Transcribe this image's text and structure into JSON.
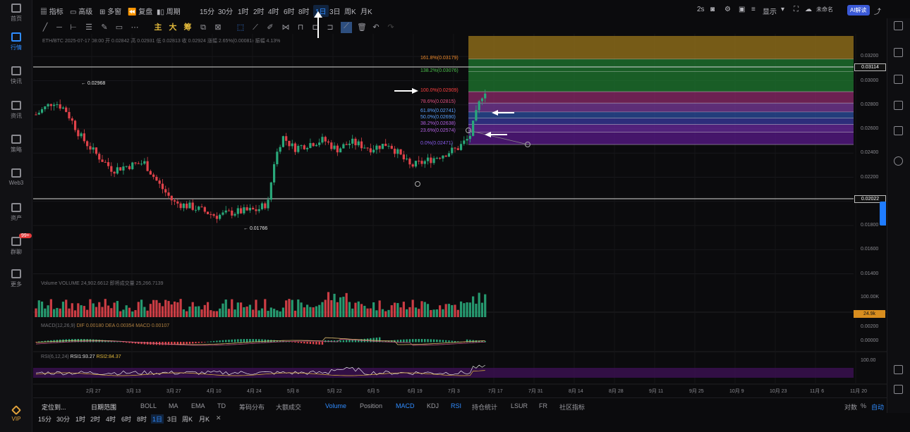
{
  "left_nav": {
    "items": [
      {
        "label": "首页",
        "icon": "home-icon"
      },
      {
        "label": "行情",
        "icon": "market-chart-icon"
      },
      {
        "label": "快讯",
        "icon": "flash-news-icon"
      },
      {
        "label": "资讯",
        "icon": "news-icon"
      },
      {
        "label": "策略",
        "icon": "strategy-icon"
      },
      {
        "label": "Web3",
        "icon": "web3-icon"
      },
      {
        "label": "资产",
        "icon": "assets-icon"
      },
      {
        "label": "群聊",
        "icon": "chat-icon"
      },
      {
        "label": "更多",
        "icon": "more-icon"
      },
      {
        "label": "VIP",
        "icon": "vip-diamond-icon"
      }
    ],
    "chat_badge": "99+"
  },
  "toolbar": {
    "indicators": "指标",
    "template": "高级",
    "multi_chart": "多窗",
    "replay": "复盘",
    "chart_type": "周期",
    "timeframes": [
      "15分",
      "30分",
      "1时",
      "2时",
      "4时",
      "6时",
      "8时",
      "1日",
      "3日",
      "周K",
      "月K"
    ],
    "active_timeframe": "1日",
    "refresh": "2s",
    "display": "显示",
    "account": "未命名",
    "ai_button": "AI解读"
  },
  "info_line": "ETH/BTC  2025-07-17 08:00  开 0.02842  高 0.02931  低 0.02813  收 0.02924  涨幅 2.65%(0.00081)  振幅 4.13%",
  "chart_data": {
    "type": "candlestick",
    "symbol": "ETH/BTC",
    "interval": "1日",
    "date": "2025-07-17",
    "high_marker": "← 0.02968",
    "low_marker": "← 0.01766",
    "price_axis": [
      "0.03200",
      "0.03000",
      "0.02800",
      "0.02600",
      "0.02400",
      "0.02200",
      "0.02000",
      "0.01800",
      "0.01600",
      "0.01400"
    ],
    "horizontal_lines": [
      {
        "label": "0.03114",
        "value": 0.03114
      },
      {
        "label": "0.02022",
        "value": 0.02022
      }
    ],
    "fibonacci": [
      {
        "label": "161.8%(0.03179)",
        "value": 0.03179,
        "color": "#f08a2a"
      },
      {
        "label": "138.2%(0.03076)",
        "value": 0.03076,
        "color": "#4cc04c"
      },
      {
        "label": "100.0%(0.02909)",
        "value": 0.02909,
        "color": "#ff4040"
      },
      {
        "label": "78.6%(0.02815)",
        "value": 0.02815,
        "color": "#e05080"
      },
      {
        "label": "61.8%(0.02741)",
        "value": 0.02741,
        "color": "#5aa0ff"
      },
      {
        "label": "50.0%(0.02690)",
        "value": 0.0269,
        "color": "#5aa0ff"
      },
      {
        "label": "38.2%(0.02638)",
        "value": 0.02638,
        "color": "#b060e0"
      },
      {
        "label": "23.6%(0.02574)",
        "value": 0.02574,
        "color": "#b060e0"
      },
      {
        "label": "0.0%(0.02471)",
        "value": 0.02471,
        "color": "#8a5cf0"
      }
    ],
    "dates": [
      "2月 27",
      "3月 13",
      "3月 27",
      "4月 10",
      "4月 24",
      "5月 8",
      "5月 22",
      "6月 5",
      "6月 19",
      "7月 3",
      "7月 17",
      "7月 31",
      "8月 14",
      "8月 28",
      "9月 11",
      "9月 25",
      "10月 9",
      "10月 23",
      "11月 6",
      "11月 20"
    ],
    "volume_axis": [
      "100.00K"
    ],
    "volume_badge": "24.9k"
  },
  "indicators": {
    "volume": "Volume  VOLUME 24,902.6612  即将成交量 25,266.7139",
    "macd_prefix": "MACD(12,26,9)",
    "macd_values": "DIF 0.00180  DEA 0.00354  MACD 0.00107",
    "macd_axis": [
      "0.00200",
      "0.00000"
    ],
    "rsi_prefix": "RSI(6,12,24)",
    "rsi1": "RSI1:93.27",
    "rsi2": "RSI2:84.37",
    "rsi_axis": [
      "100.00"
    ]
  },
  "indicator_bar": {
    "locate": "定位到...",
    "date_range": "日期范围",
    "items": [
      "BOLL",
      "MA",
      "EMA",
      "TD",
      "筹码分布",
      "大额成交"
    ],
    "sub_items": [
      "Volume",
      "Position",
      "MACD",
      "KDJ",
      "RSI",
      "持仓统计",
      "LSUR",
      "FR",
      "社区指标"
    ],
    "right_items": [
      "对数",
      "%",
      "自动"
    ]
  },
  "bottom_timeframes": [
    "15分",
    "30分",
    "1时",
    "2时",
    "4时",
    "6时",
    "8时",
    "1日",
    "3日",
    "周K",
    "月K"
  ],
  "bottom_active": "1日",
  "colors": {
    "up": "#29a87a",
    "down": "#e0424a",
    "accent": "#2f8cff",
    "fib_top": "#8a6a1a"
  }
}
